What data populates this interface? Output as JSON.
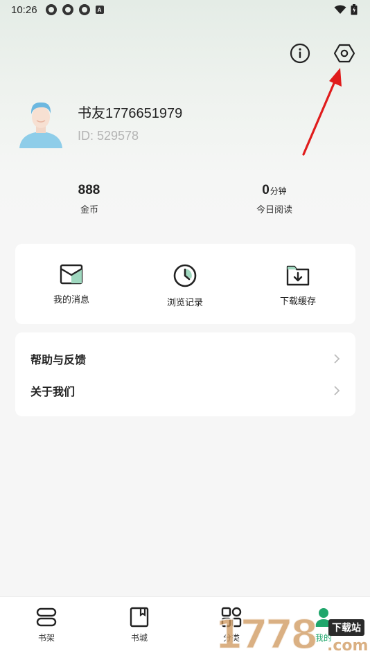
{
  "status_bar": {
    "time": "10:26",
    "left_icons": [
      "app-icon",
      "app-icon",
      "app-icon",
      "a-icon"
    ],
    "a_icon_text": "A",
    "right_icons": [
      "wifi-icon",
      "battery-icon"
    ]
  },
  "header": {
    "actions": [
      "info-icon",
      "settings-icon"
    ]
  },
  "profile": {
    "username": "书友1776651979",
    "user_id": "ID: 529578"
  },
  "stats": [
    {
      "value": "888",
      "unit": "",
      "label": "金币"
    },
    {
      "value": "0",
      "unit": "分钟",
      "label": "今日阅读"
    }
  ],
  "shortcuts": [
    {
      "icon": "message-icon",
      "label": "我的消息"
    },
    {
      "icon": "clock-icon",
      "label": "浏览记录"
    },
    {
      "icon": "download-folder-icon",
      "label": "下载缓存"
    }
  ],
  "list_items": [
    {
      "label": "帮助与反馈"
    },
    {
      "label": "关于我们"
    }
  ],
  "bottom_nav": [
    {
      "icon": "bookshelf-icon",
      "label": "书架",
      "active": false
    },
    {
      "icon": "bookstore-icon",
      "label": "书城",
      "active": false
    },
    {
      "icon": "category-icon",
      "label": "分类",
      "active": false
    },
    {
      "icon": "profile-icon",
      "label": "我的",
      "active": true
    }
  ],
  "colors": {
    "accent_green": "#1fa66b",
    "annotation_arrow": "#e01c1c",
    "icon_stroke": "#222222"
  },
  "watermark": {
    "digits": "1778",
    "tag": "下载站",
    "suffix": ".com"
  }
}
